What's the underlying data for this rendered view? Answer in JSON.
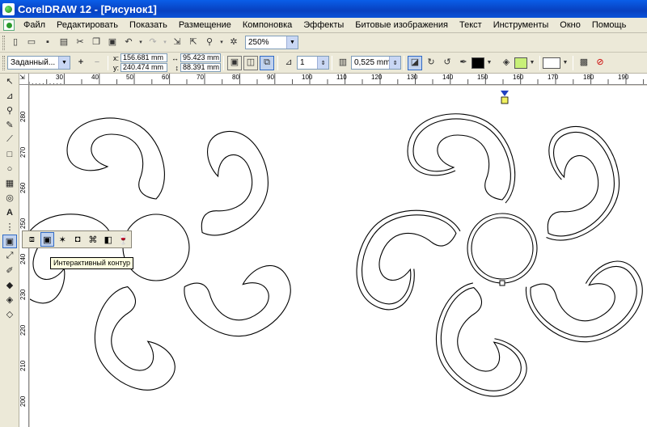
{
  "window": {
    "title": "CorelDRAW 12 - [Рисунок1]"
  },
  "menu": [
    "Файл",
    "Редактировать",
    "Показать",
    "Размещение",
    "Компоновка",
    "Эффекты",
    "Битовые изображения",
    "Текст",
    "Инструменты",
    "Окно",
    "Помощь"
  ],
  "standard_toolbar": {
    "zoom_level": "250%"
  },
  "property_bar": {
    "preset": "Заданный...",
    "x_label": "x:",
    "x_value": "156.681 mm",
    "y_label": "y:",
    "y_value": "240.474 mm",
    "width_value": "95.423 mm",
    "height_value": "88.391 mm",
    "steps_value": "1",
    "offset_value": "0,525 mm",
    "outline_color": "#000000",
    "fill_color": "#c8f078",
    "fill2_color": "#ffffff"
  },
  "ruler": {
    "h_labels": [
      "30",
      "40",
      "50",
      "60",
      "70",
      "80",
      "90",
      "100",
      "110",
      "120",
      "130",
      "140",
      "150",
      "160",
      "170",
      "180",
      "190"
    ],
    "v_labels": [
      "280",
      "270",
      "260",
      "250",
      "240",
      "230",
      "220",
      "210",
      "200"
    ]
  },
  "flyout": {
    "tooltip": "Интерактивный контур"
  }
}
